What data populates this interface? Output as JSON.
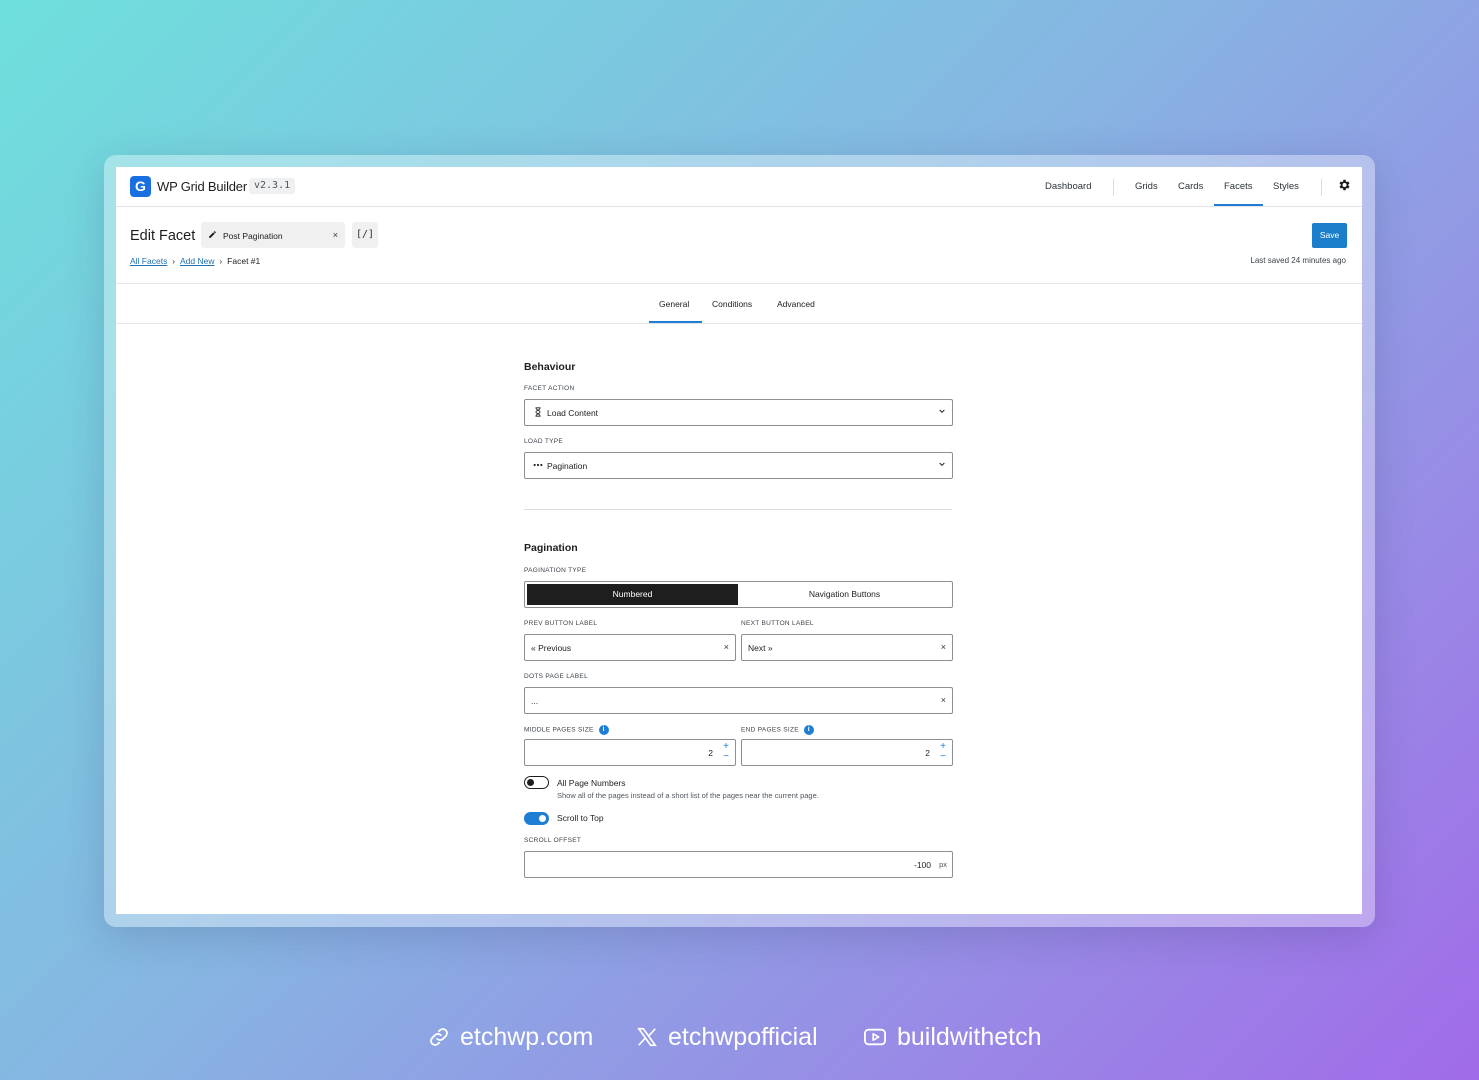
{
  "app": {
    "title": "WP Grid Builder",
    "version": "v2.3.1",
    "logo_letter": "G"
  },
  "nav": {
    "dashboard": "Dashboard",
    "grids": "Grids",
    "cards": "Cards",
    "facets": "Facets",
    "styles": "Styles",
    "active": "Facets"
  },
  "header": {
    "title": "Edit Facet",
    "facet_name": "Post Pagination",
    "code_button": "[/]",
    "save": "Save",
    "last_saved": "Last saved 24 minutes ago"
  },
  "breadcrumb": {
    "all_facets": "All Facets",
    "add_new": "Add New",
    "current": "Facet #1"
  },
  "tabs": {
    "general": "General",
    "conditions": "Conditions",
    "advanced": "Advanced",
    "active": "General"
  },
  "behaviour": {
    "title": "Behaviour",
    "facet_action_label": "FACET ACTION",
    "facet_action_value": "Load Content",
    "load_type_label": "LOAD TYPE",
    "load_type_value": "Pagination"
  },
  "pagination": {
    "title": "Pagination",
    "type_label": "PAGINATION TYPE",
    "type_options": [
      "Numbered",
      "Navigation Buttons"
    ],
    "type_selected": "Numbered",
    "prev_label": "PREV BUTTON LABEL",
    "prev_value": "« Previous",
    "next_label": "NEXT BUTTON LABEL",
    "next_value": "Next »",
    "dots_label": "DOTS PAGE LABEL",
    "dots_value": "...",
    "middle_label": "MIDDLE PAGES SIZE",
    "middle_value": "2",
    "end_label": "END PAGES SIZE",
    "end_value": "2",
    "all_pages_label": "All Page Numbers",
    "all_pages_help": "Show all of the pages instead of a short list of the pages near the current page.",
    "all_pages_on": false,
    "scroll_top_label": "Scroll to Top",
    "scroll_top_on": true,
    "scroll_offset_label": "SCROLL OFFSET",
    "scroll_offset_value": "-100",
    "scroll_offset_unit": "px"
  },
  "footer": {
    "website": "etchwp.com",
    "x_handle": "etchwpofficial",
    "youtube": "buildwithetch"
  },
  "colors": {
    "accent": "#1d7ed4",
    "logo": "#1a6fe0",
    "save": "#1a7ecb",
    "segment_active": "#1e1e1e"
  }
}
